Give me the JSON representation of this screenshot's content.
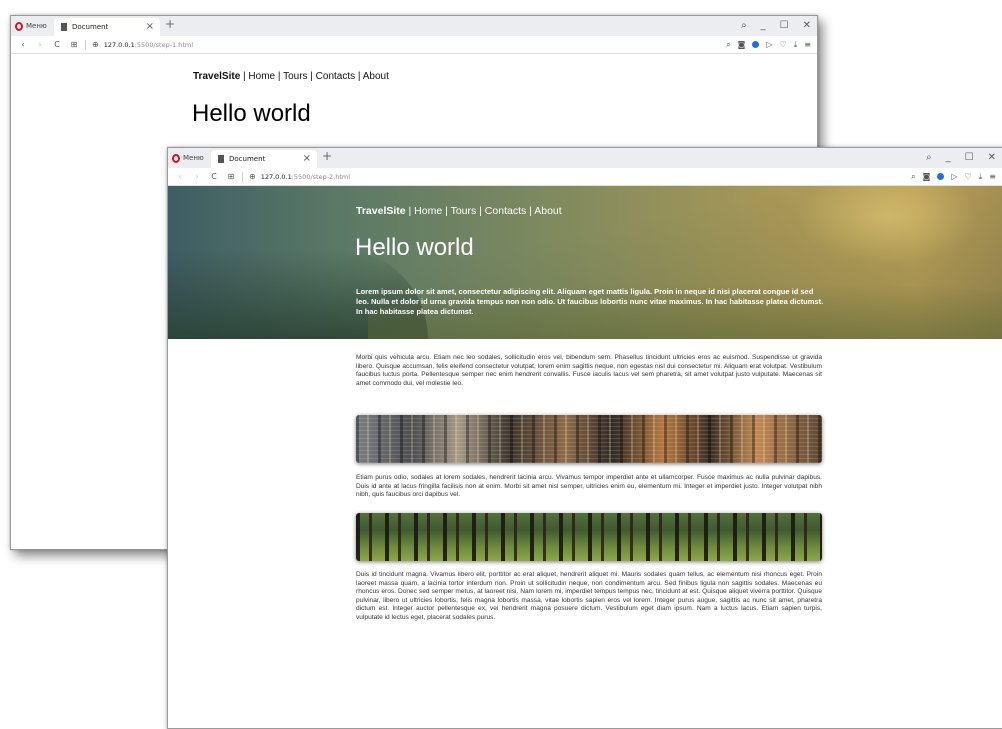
{
  "browser": {
    "menu_label": "Меню",
    "tab_title": "Document",
    "tab_close_glyph": "×",
    "new_tab_glyph": "+",
    "controls": [
      "⌕",
      "_",
      "☐",
      "✕"
    ],
    "nav": [
      "‹",
      "›",
      "C",
      "⊞"
    ],
    "tools": [
      "⌕",
      "◙",
      "▷",
      "♡",
      "⤓",
      "≡"
    ]
  },
  "window1": {
    "url_host": "127.0.0.1",
    "url_path": ":5500/step-1.html",
    "site_nav": {
      "brand": "TravelSite",
      "links": " | Home | Tours | Contacts | About"
    },
    "heading": "Hello world"
  },
  "window2": {
    "url_host": "127.0.0.1",
    "url_path": ":5500/step-2.html",
    "site_nav": {
      "brand": "TravelSite",
      "links": " | Home | Tours | Contacts | About"
    },
    "heading": "Hello world",
    "lead": "Lorem ipsum dolor sit amet, consectetur adipiscing elit. Aliquam eget mattis ligula. Proin in neque id nisi placerat congue id sed leo. Nulla et dolor id urna gravida tempus non non odio. Ut faucibus lobortis nunc vitae maximus. In hac habitasse platea dictumst. In hac habitasse platea dictumst.",
    "paragraph1": "Morbi quis vehicula arcu. Etiam nec leo sodales, sollicitudin eros vel, bibendum sem. Phasellus tincidunt ultricies eros ac euismod. Suspendisse ut gravida libero. Quisque accumsan, felis eleifend consectetur volutpat, lorem enim sagittis neque, non egestas nisl dui consectetur mi. Aliquam erat volutpat. Vestibulum faucibus luctus porta. Pellentesque semper nec enim hendrerit convallis. Fusce iaculis lacus vel sem pharetra, sit amet volutpat justo vulputate. Maecenas sit amet commodo dui, vel molestie leo.",
    "paragraph2": "Etiam purus odio, sodales at lorem sodales, hendrerit lacinia arcu. Vivamus tempor imperdiet ante et ullamcorper. Fusce maximus ac nulla pulvinar dapibus. Duis id ante at lacus fringilla facilisis non at enim. Morbi sit amet nisl semper, ultricies enim eu, elementum mi. Integer et imperdiet justo. Integer volutpat nibh nibh, quis faucibus orci dapibus vel.",
    "paragraph3": "Duis id tincidunt magna. Vivamus libero elit, porttitor ac erat aliquet, hendrerit aliquet mi. Mauris sodales quam tellus, ac elementum nisi rhoncus eget. Proin laoreet massa quam, a lacinia tortor interdum non. Proin ut sollicitudin neque, non condimentum arcu. Sed finibus ligula non sagittis sodales. Maecenas eu rhoncus eros. Donec sed semper metus, at laoreet nisi. Nam lorem mi, imperdiet tempus tempus nec, tincidunt at est. Quisque aliquet viverra porttitor. Quisque pulvinar, libero ut ultricies lobortis, felis magna lobortis massa, vitae lobortis sapien eros vel lorem. Integer purus augue, sagittis ac nunc sit amet, pharetra dictum est. Integer auctor pellentesque ex, vel hendrerit magna posuere dictum. Vestibulum eget diam ipsum. Nam a luctus lacus. Etiam sapien turpis, vulputate id lectus eget, placerat sodales purus."
  },
  "colors": {
    "opera_red": "#e0102a",
    "vpn_blue": "#1e6fe0"
  }
}
